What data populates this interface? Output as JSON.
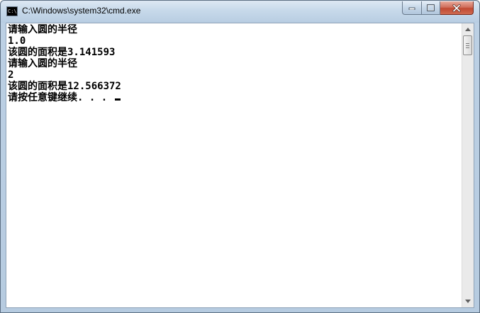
{
  "window": {
    "title": "C:\\Windows\\system32\\cmd.exe",
    "icon_label": "C:\\"
  },
  "controls": {
    "minimize_icon": "minimize-icon",
    "maximize_icon": "maximize-icon",
    "close_icon": "close-icon"
  },
  "console": {
    "lines": [
      "请输入圆的半径",
      "1.0",
      "该圆的面积是3.141593",
      "请输入圆的半径",
      "2",
      "该圆的面积是12.566372",
      "请按任意键继续. . . "
    ]
  }
}
